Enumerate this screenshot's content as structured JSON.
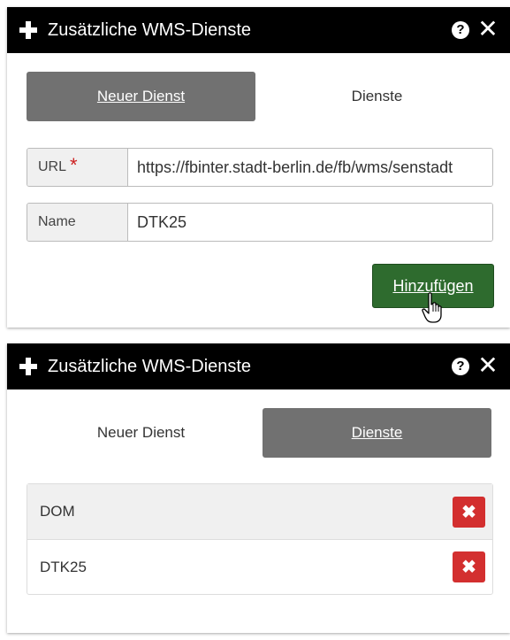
{
  "panel_top": {
    "title": "Zusätzliche WMS-Dienste",
    "tabs": [
      {
        "label": "Neuer Dienst",
        "active": true
      },
      {
        "label": "Dienste",
        "active": false
      }
    ],
    "url_label": "URL",
    "required_marker": "*",
    "url_value": "https://fbinter.stadt-berlin.de/fb/wms/senstadt",
    "name_label": "Name",
    "name_value": "DTK25",
    "add_button": "Hinzufügen",
    "help_glyph": "?",
    "close_glyph": "✕"
  },
  "panel_bottom": {
    "title": "Zusätzliche WMS-Dienste",
    "tabs": [
      {
        "label": "Neuer Dienst",
        "active": false
      },
      {
        "label": "Dienste",
        "active": true
      }
    ],
    "services": [
      {
        "name": "DOM"
      },
      {
        "name": "DTK25"
      }
    ],
    "delete_glyph": "✖",
    "help_glyph": "?",
    "close_glyph": "✕"
  },
  "colors": {
    "titlebar": "#000000",
    "tab_active": "#717171",
    "add_button": "#2e6b2e",
    "delete_button": "#d32f2f",
    "required": "#cc1f1f"
  },
  "icons": {
    "plus": "plus-icon",
    "help": "help-icon",
    "close": "close-icon",
    "delete": "delete-icon",
    "cursor": "hand-cursor-icon"
  }
}
